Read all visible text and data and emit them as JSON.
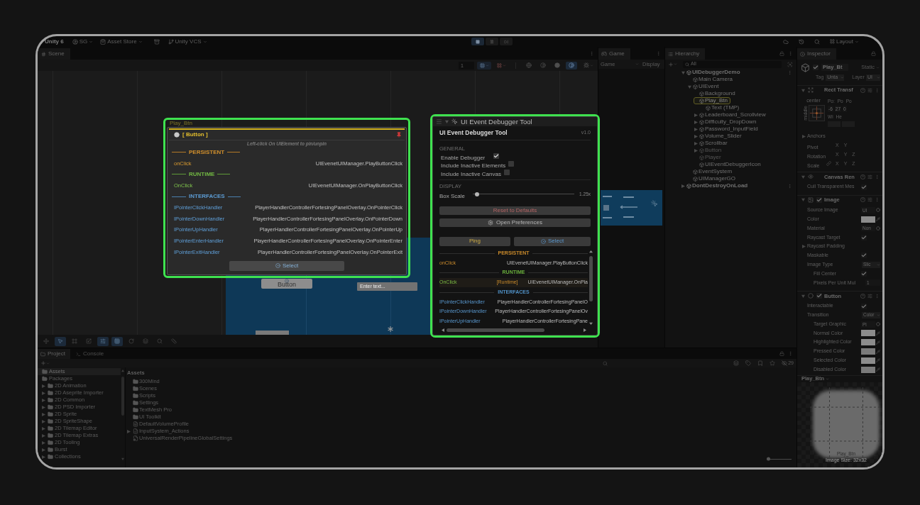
{
  "toolbar": {
    "app": "Unity 6",
    "account": "SG",
    "asset_store": "Asset Store",
    "vcs": "Unity VCS",
    "playing": true,
    "layout": "Layout"
  },
  "scene": {
    "tab": "Scene",
    "zoom_field": "1",
    "shading_modes": [
      {
        "selected": false
      },
      {
        "selected": false
      },
      {
        "selected": false
      },
      {
        "selected": true
      }
    ],
    "scene_button": "Button",
    "scene_input": "Enter text...",
    "tools": [
      {
        "selected": false
      },
      {
        "selected": true
      },
      {
        "selected": false
      },
      {
        "selected": false
      },
      {
        "selected": true
      },
      {
        "selected": true
      },
      {
        "selected": false
      },
      {
        "selected": false
      },
      {
        "selected": false
      },
      {
        "selected": false
      }
    ]
  },
  "inspect_popup": {
    "target": "Play_Btn",
    "header": "[ Button ]",
    "pinned": true,
    "hint": "Left-click On UIElement to pin/unpin",
    "sections": [
      {
        "kind": "persistent",
        "label": "PERSISTENT",
        "rows": [
          {
            "event": "onClick",
            "target": "UIEvenetUIManager.PlayButtonClick"
          }
        ]
      },
      {
        "kind": "runtime",
        "label": "RUNTIME",
        "rows": [
          {
            "event": "OnClick",
            "target": "UIEvenetUIManager.OnPlayButtonClick"
          }
        ]
      },
      {
        "kind": "interfaces",
        "label": "INTERFACES",
        "rows": [
          {
            "event": "IPointerClickHandler",
            "target": "PlayerHandlerControllerFortesingPanelOverlay.OnPointerClick"
          },
          {
            "event": "IPointerDownHandler",
            "target": "PlayerHandlerControllerFortesingPanelOverlay.OnPointerDown"
          },
          {
            "event": "IPointerUpHandler",
            "target": "PlayerHandlerControllerFortesingPanelOverlay.OnPointerUp"
          },
          {
            "event": "IPointerEnterHandler",
            "target": "PlayerHandlerControllerFortesingPanelOverlay.OnPointerEnter"
          },
          {
            "event": "IPointerExitHandler",
            "target": "PlayerHandlerControllerFortesingPanelOverlay.OnPointerExit"
          }
        ]
      }
    ],
    "select": "Select"
  },
  "debugger": {
    "title": "UI Event Debugger Tool",
    "heading": "UI Event Debugger Tool",
    "version": "v1.0",
    "general": {
      "label": "GENERAL",
      "options": [
        {
          "label": "Enable Debugger",
          "checked": true
        },
        {
          "label": "Include Inactive Elements",
          "checked": false
        },
        {
          "label": "Include Inactive Canvas",
          "checked": false
        }
      ]
    },
    "display": {
      "label": "DISPLAY",
      "box_scale": {
        "label": "Box Scale",
        "level": 0.02,
        "reading": "1.25x"
      }
    },
    "buttons": [
      {
        "kind": "reset",
        "label": "Reset to Defaults"
      },
      {
        "kind": "preferences",
        "label": "Open Preferences"
      }
    ],
    "actions": [
      {
        "kind": "ping",
        "label": "Ping"
      },
      {
        "kind": "select",
        "label": "Select"
      }
    ],
    "sections": [
      {
        "kind": "persistent",
        "label": "PERSISTENT",
        "rows": [
          {
            "event": "onClick",
            "target": "UIEvenetUIManager.PlayButtonClick",
            "highlighted": false
          }
        ]
      },
      {
        "kind": "runtime",
        "label": "RUNTIME",
        "rows": [
          {
            "event": "OnClick",
            "tag": "[Runtime]",
            "target": "UIEvenetUIManager.OnPla",
            "highlighted": true
          }
        ]
      },
      {
        "kind": "interfaces",
        "label": "INTERFACES",
        "rows": [
          {
            "event": "IPointerClickHandler",
            "target": "PlayerHandlerControllerFortesingPanelO",
            "highlighted": false
          },
          {
            "event": "IPointerDownHandler",
            "target": "PlayerHandlerControllerFortesingPanelOv",
            "highlighted": false
          },
          {
            "event": "IPointerUpHandler",
            "target": "PlayerHandlerControllerFortesingPane",
            "highlighted": false
          }
        ]
      }
    ]
  },
  "game": {
    "tab": "Game",
    "view": "Game",
    "display": "Display"
  },
  "hierarchy": {
    "tab": "Hierarchy",
    "search_placeholder": "All",
    "tree": [
      {
        "label": "UIDebuggerDemo",
        "kind": "scene",
        "expanded": true,
        "selected": false,
        "disabled": false,
        "children": [
          {
            "label": "Main Camera",
            "kind": "object",
            "selected": false,
            "disabled": false
          },
          {
            "label": "UIEvent",
            "kind": "object",
            "expanded": true,
            "selected": false,
            "disabled": false,
            "children": [
              {
                "label": "Background",
                "kind": "object",
                "selected": false,
                "disabled": false
              },
              {
                "label": "Play_Btn",
                "kind": "object",
                "selected": true,
                "disabled": false,
                "children": [
                  {
                    "label": "Text (TMP)",
                    "kind": "object",
                    "selected": false,
                    "disabled": false
                  }
                ]
              },
              {
                "label": "Leaderboard_Scrollview",
                "kind": "object",
                "expanded": false,
                "selected": false,
                "disabled": false
              },
              {
                "label": "Difficulty_DropDown",
                "kind": "object",
                "expanded": false,
                "selected": false,
                "disabled": false
              },
              {
                "label": "Password_InputField",
                "kind": "object",
                "expanded": false,
                "selected": false,
                "disabled": false
              },
              {
                "label": "Volume_Slider",
                "kind": "object",
                "expanded": false,
                "selected": false,
                "disabled": false
              },
              {
                "label": "Scrollbar",
                "kind": "object",
                "expanded": false,
                "selected": false,
                "disabled": false
              },
              {
                "label": "Button",
                "kind": "object",
                "expanded": false,
                "selected": false,
                "disabled": true
              },
              {
                "label": "Player",
                "kind": "object",
                "selected": false,
                "disabled": true
              },
              {
                "label": "UIEventDebuggerIcon",
                "kind": "object",
                "selected": false,
                "disabled": false
              }
            ]
          },
          {
            "label": "EventSystem",
            "kind": "object",
            "selected": false,
            "disabled": false
          },
          {
            "label": "UIManagerGO",
            "kind": "object",
            "selected": false,
            "disabled": false
          }
        ]
      },
      {
        "label": "DontDestroyOnLoad",
        "kind": "scene",
        "expanded": false,
        "selected": false,
        "disabled": false
      }
    ]
  },
  "inspector": {
    "tab": "Inspector",
    "active": true,
    "name": "Play_Bt",
    "static": "Static",
    "tag_label": "Tag",
    "tag": "Unta",
    "layer_label": "Layer",
    "layer": "UI",
    "components": [
      {
        "kind": "rect_transform",
        "title": "Rect Transf",
        "expanded": true,
        "anchor": "center",
        "anchor_side": "middle",
        "pos_labels": [
          "Po:",
          "Po",
          "Po"
        ],
        "pos_values": [
          "-6",
          "27",
          "0"
        ],
        "size_labels": [
          "Wi",
          "He"
        ],
        "fields": [
          {
            "kind": "foldout",
            "label": "Anchors",
            "expanded": false
          },
          {
            "kind": "axes",
            "label": "Pivot",
            "axes": [
              "X",
              "Y"
            ]
          },
          {
            "kind": "axes",
            "label": "Rotation",
            "axes": [
              "X",
              "Y",
              "Z"
            ]
          },
          {
            "kind": "linked_axes",
            "label": "Scale",
            "axes": [
              "X",
              "Y",
              "Z"
            ]
          }
        ]
      },
      {
        "kind": "canvas_renderer",
        "title": "Canvas Ren",
        "expanded": true,
        "fields": [
          {
            "kind": "check",
            "label": "Cull Transparent Mes",
            "checked": true
          }
        ]
      },
      {
        "kind": "image",
        "title": "Image",
        "enabled": true,
        "expanded": true,
        "fields": [
          {
            "kind": "object",
            "label": "Source Image",
            "value": "UI"
          },
          {
            "kind": "swatch",
            "label": "Color",
            "color": "#8c8c8c"
          },
          {
            "kind": "object",
            "label": "Material",
            "value": "Non"
          },
          {
            "kind": "check",
            "label": "Raycast Target",
            "checked": true
          },
          {
            "kind": "foldout",
            "label": "Raycast Padding",
            "expanded": false
          },
          {
            "kind": "check",
            "label": "Maskable",
            "checked": true
          },
          {
            "kind": "dropdown",
            "label": "Image Type",
            "value": "Slic",
            "children": [
              {
                "kind": "check",
                "label": "Fill Center",
                "checked": true
              },
              {
                "kind": "text",
                "label": "Pixels Per Unit Mul",
                "value": "1"
              }
            ]
          }
        ]
      },
      {
        "kind": "button",
        "title": "Button",
        "enabled": true,
        "expanded": true,
        "fields": [
          {
            "kind": "check",
            "label": "Interactable",
            "checked": true
          },
          {
            "kind": "dropdown",
            "label": "Transition",
            "value": "Color",
            "children": [
              {
                "kind": "object",
                "label": "Target Graphic",
                "value": "Pl"
              },
              {
                "kind": "swatch",
                "label": "Normal Color",
                "color": "#8c8c8c"
              },
              {
                "kind": "swatch",
                "label": "Highlighted Color",
                "color": "#8c8c8c"
              },
              {
                "kind": "swatch",
                "label": "Pressed Color",
                "color": "#7a7a7a"
              },
              {
                "kind": "swatch",
                "label": "Selected Color",
                "color": "#8c8c8c"
              },
              {
                "kind": "swatch",
                "label": "Disabled Color",
                "color": "#7a7a7a"
              }
            ]
          }
        ]
      }
    ],
    "preview": {
      "title": "Play_Btn",
      "label": "Play_Btn",
      "size": "Image Size: 32x32"
    }
  },
  "project": {
    "tabs": [
      {
        "kind": "project",
        "label": "Project",
        "selected": true
      },
      {
        "kind": "console",
        "label": "Console",
        "selected": false
      }
    ],
    "hidden_count": "29",
    "tree": [
      {
        "label": "Assets",
        "kind": "folder",
        "selected": true
      },
      {
        "label": "Packages",
        "kind": "open_folder",
        "selected": false,
        "children": [
          {
            "label": "2D Animation",
            "kind": "folder",
            "expanded": false,
            "selected": false
          },
          {
            "label": "2D Aseprite Importer",
            "kind": "folder",
            "expanded": false,
            "selected": false
          },
          {
            "label": "2D Common",
            "kind": "folder",
            "expanded": false,
            "selected": false
          },
          {
            "label": "2D PSD Importer",
            "kind": "folder",
            "expanded": false,
            "selected": false
          },
          {
            "label": "2D Sprite",
            "kind": "folder",
            "expanded": false,
            "selected": false
          },
          {
            "label": "2D SpriteShape",
            "kind": "folder",
            "expanded": false,
            "selected": false
          },
          {
            "label": "2D Tilemap Editor",
            "kind": "folder",
            "expanded": false,
            "selected": false
          },
          {
            "label": "2D Tilemap Extras",
            "kind": "folder",
            "expanded": false,
            "selected": false
          },
          {
            "label": "2D Tooling",
            "kind": "folder",
            "expanded": false,
            "selected": false
          },
          {
            "label": "Burst",
            "kind": "folder",
            "expanded": false,
            "selected": false
          },
          {
            "label": "Collections",
            "kind": "folder",
            "expanded": false,
            "selected": false
          }
        ]
      }
    ],
    "breadcrumb": "Assets",
    "items": [
      {
        "label": "300Mind",
        "kind": "folder"
      },
      {
        "label": "Scenes",
        "kind": "folder"
      },
      {
        "label": "Scripts",
        "kind": "folder"
      },
      {
        "label": "Settings",
        "kind": "folder"
      },
      {
        "label": "TextMesh Pro",
        "kind": "folder"
      },
      {
        "label": "UI Toolkit",
        "kind": "folder"
      },
      {
        "label": "DefaultVolumeProfile",
        "kind": "asset"
      },
      {
        "label": "InputSystem_Actions",
        "kind": "input_asset",
        "expanded": false
      },
      {
        "label": "UniversalRenderPipelineGlobalSettings",
        "kind": "settings_asset"
      }
    ],
    "zoom": {
      "level": 0
    }
  }
}
